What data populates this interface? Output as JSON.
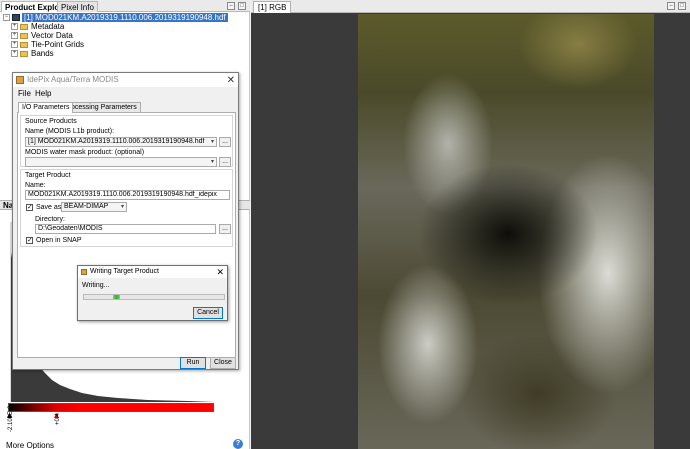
{
  "left_tabs": {
    "product_explorer": "Product Explorer",
    "pixel_info": "Pixel Info"
  },
  "tree": {
    "product": "[1] MOD021KM.A2019319.1110.006.2019319190948.hdf",
    "children": [
      "Metadata",
      "Vector Data",
      "Tie-Point Grids",
      "Bands"
    ]
  },
  "navigation": {
    "header_label": "Nav",
    "slider_min_label": "-2.100E-2",
    "slider_max_label": "+0.4",
    "more_options": "More Options",
    "help_glyph": "?"
  },
  "image_view": {
    "tab_label": "[1] RGB"
  },
  "dialog": {
    "title": "IdePix Aqua/Terra MODIS",
    "menu": {
      "file": "File",
      "help": "Help"
    },
    "tabs": {
      "io": "I/O Parameters",
      "processing": "Processing Parameters"
    },
    "source": {
      "section_label": "Source Products",
      "name_label": "Name (MODIS L1b product):",
      "name_value": "[1] MOD021KM.A2019319.1110.006.2019319190948.hdf",
      "mask_label": "MODIS water mask product: (optional)",
      "mask_value": ""
    },
    "target": {
      "section_label": "Target Product",
      "name_label": "Name:",
      "name_value": "MOD021KM.A2019319.1110.006.2019319190948.hdf_idepix",
      "save_as_label": "Save as:",
      "save_as_checked": true,
      "format_value": "BEAM-DIMAP",
      "directory_label": "Directory:",
      "directory_value": "D:\\Geodaten\\MODIS",
      "open_in_snap_label": "Open in SNAP",
      "open_in_snap_checked": true
    },
    "buttons": {
      "dots": "...",
      "run": "Run",
      "close": "Close"
    }
  },
  "progress_dialog": {
    "title": "Writing Target Product",
    "status": "Writing...",
    "cancel": "Cancel",
    "progress_fraction": 0.05
  },
  "colors": {
    "selection": "#3975c6",
    "accent_default_button": "#0078d7",
    "progress_green": "#2bb02b"
  }
}
